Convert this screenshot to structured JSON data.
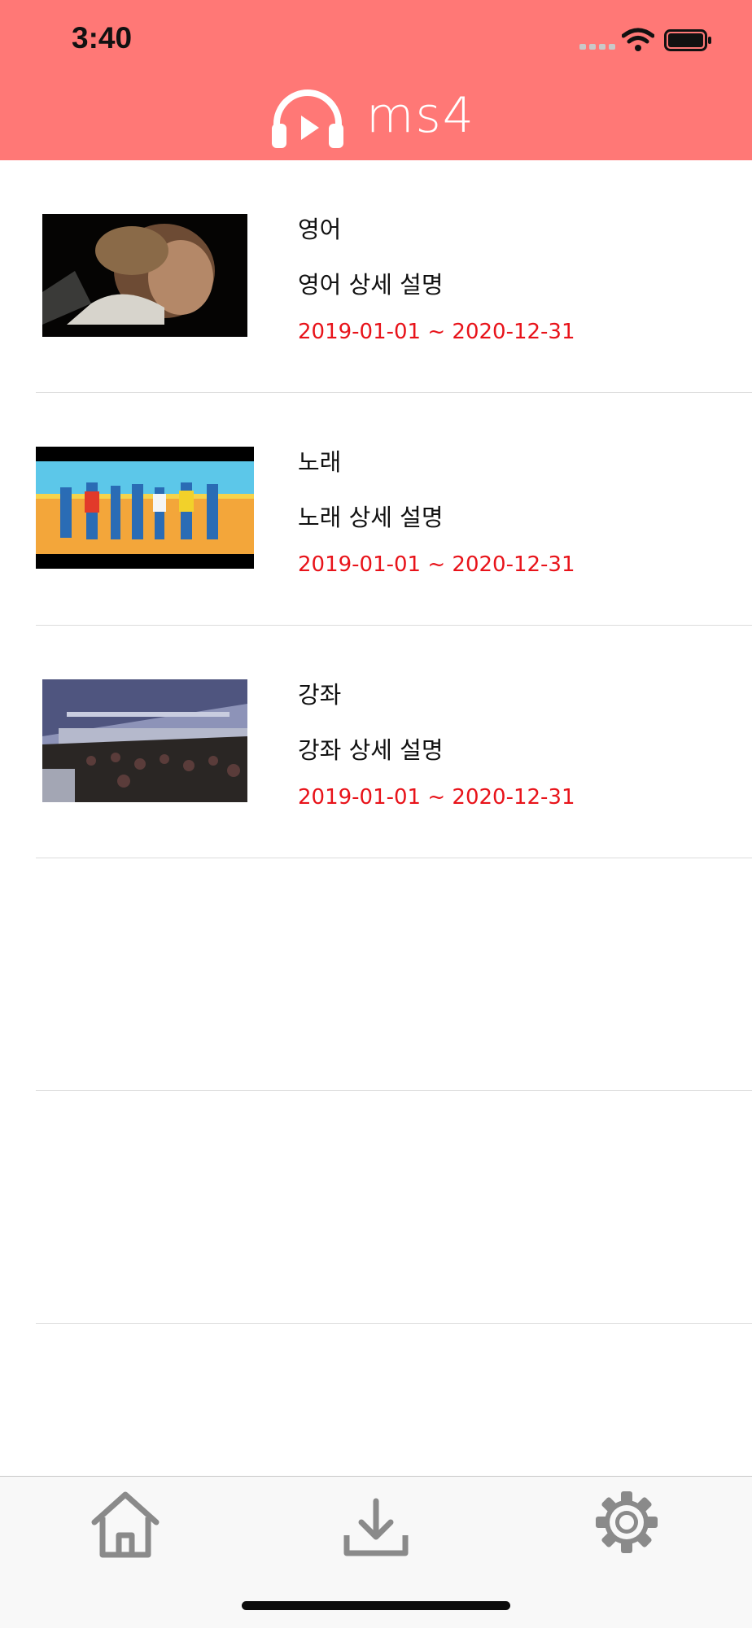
{
  "status_bar": {
    "time": "3:40"
  },
  "header": {
    "logo_text": "ms4"
  },
  "items": [
    {
      "title": "영어",
      "description": "영어 상세 설명",
      "period": "2019-01-01 ~ 2020-12-31",
      "thumbnail": "man-face-closeup"
    },
    {
      "title": "노래",
      "description": "노래 상세 설명",
      "period": "2019-01-01 ~ 2020-12-31",
      "thumbnail": "music-video-group"
    },
    {
      "title": "강좌",
      "description": "강좌 상세 설명",
      "period": "2019-01-01 ~ 2020-12-31",
      "thumbnail": "lecture-hall"
    }
  ],
  "tab_bar": {
    "tabs": [
      "home-icon",
      "download-icon",
      "settings-icon"
    ]
  },
  "colors": {
    "header": "#ff7876",
    "period_text": "#e8131a",
    "tab_icon": "#8a8a8a"
  }
}
